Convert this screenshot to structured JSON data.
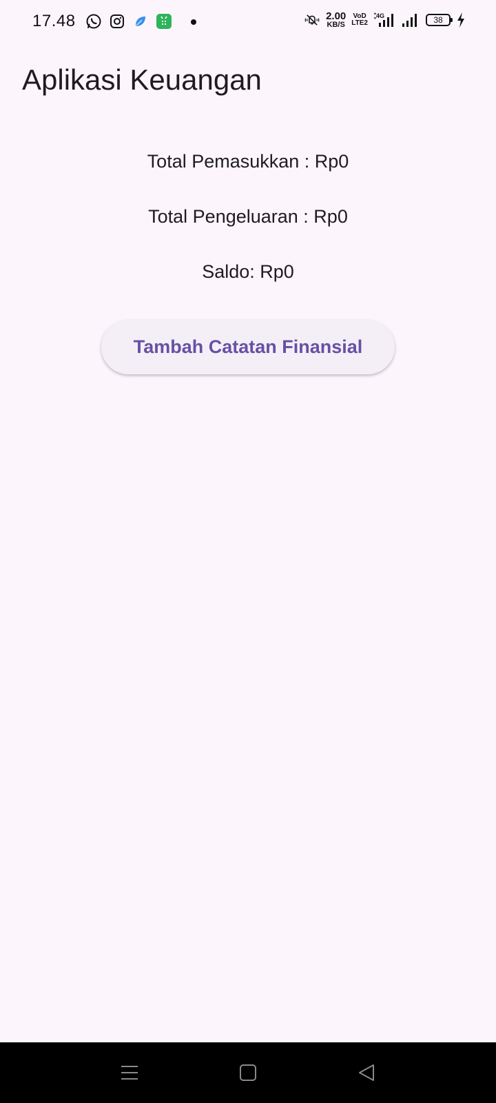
{
  "status_bar": {
    "time": "17.48",
    "net_speed_value": "2.00",
    "net_speed_unit": "KB/S",
    "volte_top": "VoD",
    "volte_bottom": "LTE2",
    "network_type": "4G",
    "battery_level": "38",
    "left_icons": [
      "whatsapp-icon",
      "instagram-icon",
      "app-blue-icon",
      "app-green-icon"
    ]
  },
  "app": {
    "title": "Aplikasi Keuangan"
  },
  "summary": {
    "income_label": "Total Pemasukkan : Rp0",
    "expense_label": "Total Pengeluaran : Rp0",
    "balance_label": "Saldo: Rp0"
  },
  "actions": {
    "add_record_label": "Tambah Catatan Finansial"
  },
  "colors": {
    "background": "#fcf6fc",
    "button_text": "#6750a4",
    "button_bg": "#f4eff6",
    "nav_bar": "#000000"
  }
}
